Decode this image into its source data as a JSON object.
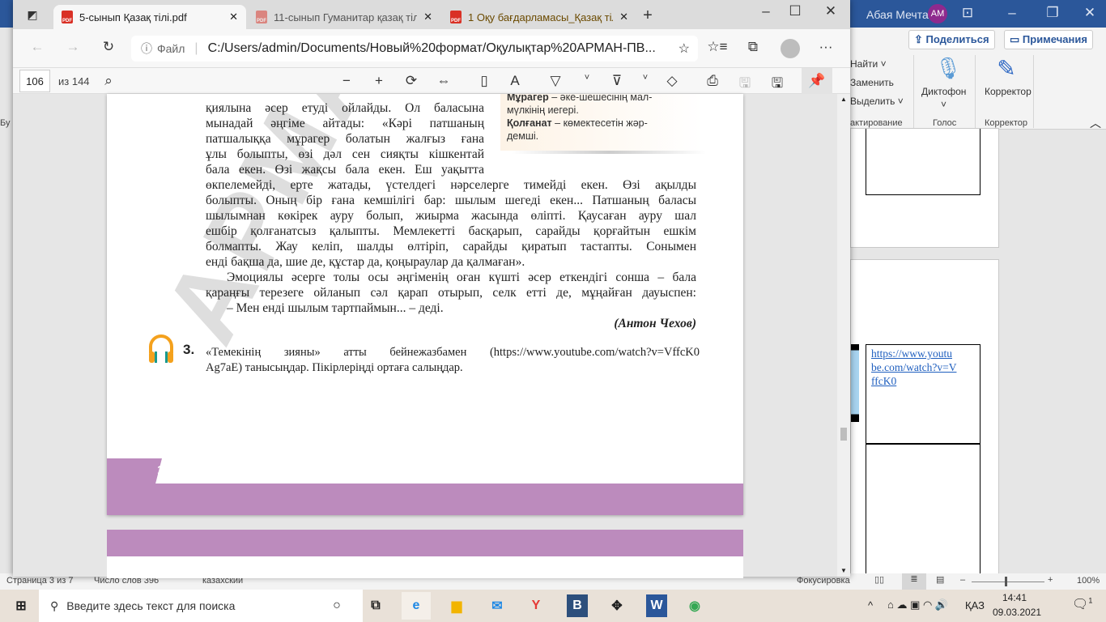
{
  "word": {
    "user_name": "Абая Мечта",
    "user_initials": "AM",
    "share_label": "Поделиться",
    "comments_label": "Примечания",
    "find_label": "Найти",
    "replace_label": "Заменить",
    "select_label": "Выделить",
    "editing_group": "актирование",
    "dictate_label": "Диктофон",
    "voice_group": "Голос",
    "editor_label": "Корректор",
    "editor_group": "Корректор",
    "left_ribbon_cut": "Бу",
    "link_lines": [
      "https://www.youtu",
      "be.com/watch?v=V",
      "ffcK0"
    ],
    "status": {
      "page": "Страница 3 из 7",
      "words": "Число слов 396",
      "language": "казахский",
      "focus": "Фокусировка",
      "zoom": "100%"
    },
    "zoom_level_percent": 100
  },
  "edge": {
    "tabs": [
      {
        "title": "5-сынып Қазақ тілі.pdf",
        "active": true
      },
      {
        "title": "11-сынып Гуманитар қазақ тілі",
        "active": false
      },
      {
        "title": "1 Оқу бағдарламасы_Қазақ тілі.",
        "active": false
      }
    ],
    "pdf_badge": "PDF",
    "address_prefix": "Файл",
    "address": "C:/Users/admin/Documents/Новый%20формат/Оқулықтар%20АРМАН-ПВ...",
    "page_current": "106",
    "page_total": "из 144"
  },
  "pdf": {
    "glossary": [
      {
        "term": "Мұрагер",
        "def": " – әке-шешесінің мал-"
      },
      {
        "term": "",
        "def": "мүлкінің иегері."
      },
      {
        "term": "Қолғанат",
        "def": " – көмектесетін жәр-"
      },
      {
        "term": "",
        "def": "демші."
      }
    ],
    "narrow_lines": [
      "қиялына әсер етуді ойлайды. Ол баласына",
      "мынадай әңгіме айтады: «Кәрі патшаның",
      "патшалыққа мұрагер болатын жалғыз ғана",
      "ұлы болыпты, өзі дәл сен сияқты кішкентай",
      "бала екен. Өзі жақсы бала екен. Еш уақытта"
    ],
    "wide_lines": [
      "өкпелемейді, ерте жатады, үстелдегі нәрселерге тимейді екен. Өзі ақылды",
      "болыпты. Оның бір ғана кемшілігі бар: шылым шегеді екен... Патшаның баласы",
      "шылымнан көкірек ауру болып, жиырма жасында өліпті. Қаусаған ауру шал",
      "ешбір қолғанатсыз қалыпты. Мемлекетті басқарып, сарайды қорғайтын ешкім",
      "болмапты. Жау келіп, шалды өлтіріп, сарайды қиратып тастапты. Сонымен",
      "енді бақша да, шие де, құстар да, қоңыраулар да қалмаған»."
    ],
    "para2": [
      "Эмоциялы әсерге толы осы әңгіменің оған күшті әсер еткендігі сонша – бала",
      "қараңғы терезеге ойланып сәл қарап отырып, селк етті де, мұңайған дауыспен:"
    ],
    "quote": "– Мен енді шылым тартпаймын... – деді.",
    "author": "(Антон Чехов)",
    "task_number": "3.",
    "task_lines": [
      "«Темекінің зияны» атты бейнежазбамен (https://www.youtube.com/watch?v=VffcK0",
      "Ag7aE) танысыңдар. Пікірлеріңді ортаға салыңдар."
    ],
    "page_number": "106",
    "watermark": "АРМАН-ПВ"
  },
  "taskbar": {
    "search_placeholder": "Введите здесь текст для поиска",
    "language": "ҚАЗ",
    "time": "14:41",
    "date": "09.03.2021",
    "notifications": "1"
  }
}
